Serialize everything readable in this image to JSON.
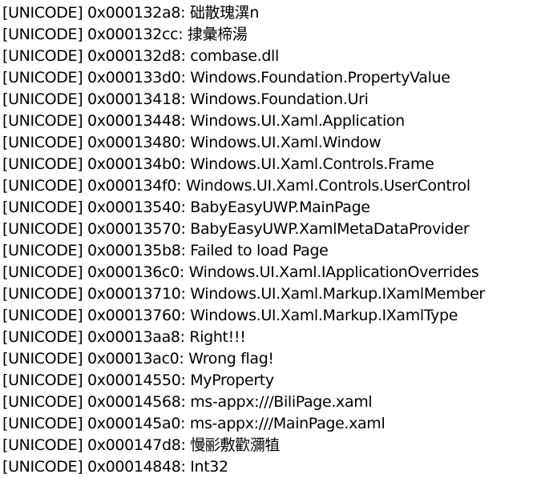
{
  "lines": [
    {
      "encoding": "[UNICODE]",
      "address": "0x000132a8",
      "value": "础散瑰潩n"
    },
    {
      "encoding": "[UNICODE]",
      "address": "0x000132cc",
      "value": "捸彙楴湯"
    },
    {
      "encoding": "[UNICODE]",
      "address": "0x000132d8",
      "value": "combase.dll"
    },
    {
      "encoding": "[UNICODE]",
      "address": "0x000133d0",
      "value": "Windows.Foundation.PropertyValue"
    },
    {
      "encoding": "[UNICODE]",
      "address": "0x00013418",
      "value": "Windows.Foundation.Uri"
    },
    {
      "encoding": "[UNICODE]",
      "address": "0x00013448",
      "value": "Windows.UI.Xaml.Application"
    },
    {
      "encoding": "[UNICODE]",
      "address": "0x00013480",
      "value": "Windows.UI.Xaml.Window"
    },
    {
      "encoding": "[UNICODE]",
      "address": "0x000134b0",
      "value": "Windows.UI.Xaml.Controls.Frame"
    },
    {
      "encoding": "[UNICODE]",
      "address": "0x000134f0",
      "value": "Windows.UI.Xaml.Controls.UserControl"
    },
    {
      "encoding": "[UNICODE]",
      "address": "0x00013540",
      "value": "BabyEasyUWP.MainPage"
    },
    {
      "encoding": "[UNICODE]",
      "address": "0x00013570",
      "value": "BabyEasyUWP.XamlMetaDataProvider"
    },
    {
      "encoding": "[UNICODE]",
      "address": "0x000135b8",
      "value": "Failed to load Page"
    },
    {
      "encoding": "[UNICODE]",
      "address": "0x000136c0",
      "value": "Windows.UI.Xaml.IApplicationOverrides"
    },
    {
      "encoding": "[UNICODE]",
      "address": "0x00013710",
      "value": "Windows.UI.Xaml.Markup.IXamlMember"
    },
    {
      "encoding": "[UNICODE]",
      "address": "0x00013760",
      "value": "Windows.UI.Xaml.Markup.IXamlType"
    },
    {
      "encoding": "[UNICODE]",
      "address": "0x00013aa8",
      "value": "Right!!!"
    },
    {
      "encoding": "[UNICODE]",
      "address": "0x00013ac0",
      "value": "Wrong flag!"
    },
    {
      "encoding": "[UNICODE]",
      "address": "0x00014550",
      "value": "MyProperty"
    },
    {
      "encoding": "[UNICODE]",
      "address": "0x00014568",
      "value": "ms-appx:///BiliPage.xaml"
    },
    {
      "encoding": "[UNICODE]",
      "address": "0x000145a0",
      "value": "ms-appx:///MainPage.xaml"
    },
    {
      "encoding": "[UNICODE]",
      "address": "0x000147d8",
      "value": "慢彨敷歡瀰犆"
    },
    {
      "encoding": "[UNICODE]",
      "address": "0x00014848",
      "value": "Int32"
    }
  ]
}
